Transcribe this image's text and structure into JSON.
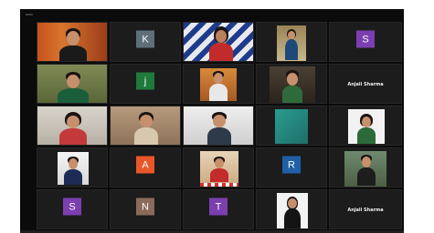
{
  "meeting": {
    "tiles": [
      {
        "name": "",
        "initial": ""
      },
      {
        "name": "",
        "initial": "K",
        "badge_color": "#5f6f78"
      },
      {
        "name": "",
        "initial": ""
      },
      {
        "name": "",
        "initial": ""
      },
      {
        "name": "",
        "initial": "S",
        "badge_color": "#7b3fb0"
      },
      {
        "name": "",
        "initial": ""
      },
      {
        "name": "",
        "initial": "j",
        "badge_color": "#1f7a3c"
      },
      {
        "name": "",
        "initial": ""
      },
      {
        "name": "",
        "initial": ""
      },
      {
        "name": "Anjali Sharma",
        "initial": ""
      },
      {
        "name": "",
        "initial": ""
      },
      {
        "name": "",
        "initial": ""
      },
      {
        "name": "",
        "initial": ""
      },
      {
        "name": "",
        "initial": ""
      },
      {
        "name": "",
        "initial": ""
      },
      {
        "name": "",
        "initial": ""
      },
      {
        "name": "",
        "initial": "A",
        "badge_color": "#e8572a"
      },
      {
        "name": "",
        "initial": ""
      },
      {
        "name": "",
        "initial": "R",
        "badge_color": "#1f5fa6"
      },
      {
        "name": "",
        "initial": ""
      },
      {
        "name": "",
        "initial": "S",
        "badge_color": "#7b3fb0"
      },
      {
        "name": "",
        "initial": "N",
        "badge_color": "#8a6a5a"
      },
      {
        "name": "",
        "initial": "T",
        "badge_color": "#7b3fb0"
      },
      {
        "name": "",
        "initial": ""
      },
      {
        "name": "Anjali Sharma",
        "initial": ""
      }
    ]
  }
}
